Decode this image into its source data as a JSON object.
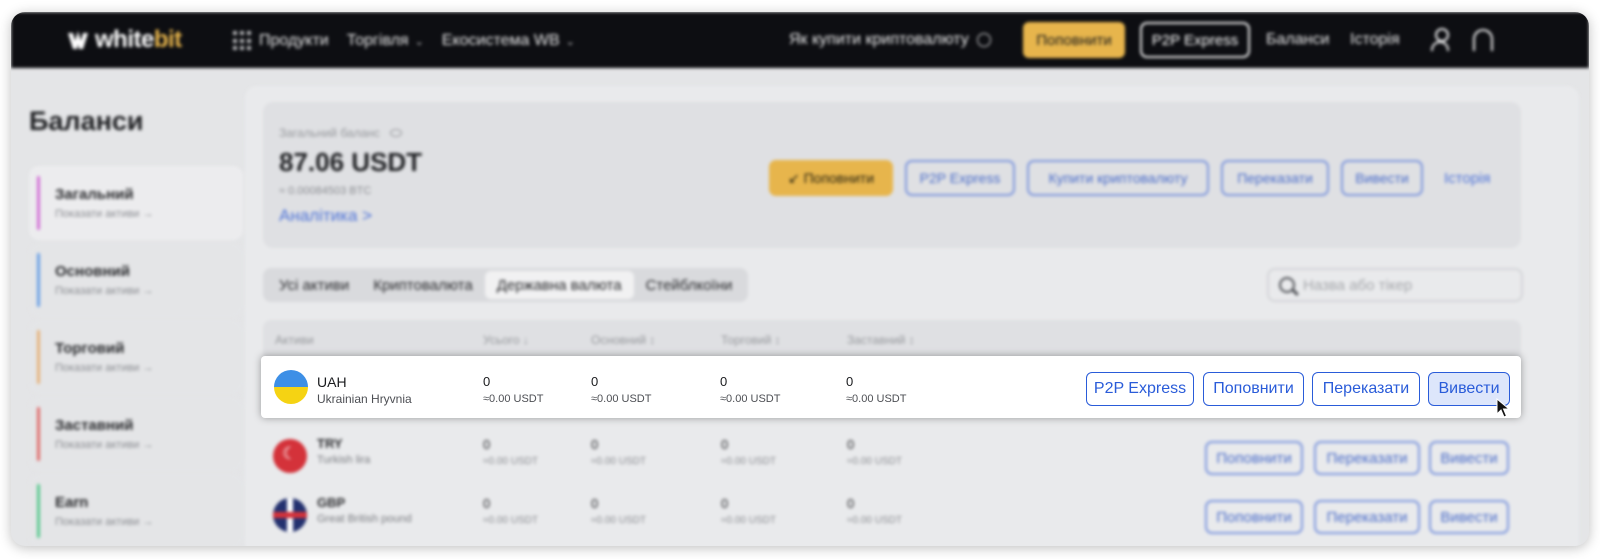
{
  "nav": {
    "logo_left": "white",
    "logo_right": "bit",
    "products": "Продукти",
    "trading": "Торгівля",
    "ecosystem": "Екосистема WB",
    "how_to_buy": "Як купити криптовалюту",
    "deposit": "Поповнити",
    "p2p": "P2P Express",
    "balances": "Баланси",
    "history": "Історія"
  },
  "sidebar": {
    "title": "Баланси",
    "items": [
      {
        "label": "Загальний",
        "sub": "Показати активи →",
        "color": "#d36fd6"
      },
      {
        "label": "Основний",
        "sub": "Показати активи →",
        "color": "#6aa0e6"
      },
      {
        "label": "Торговий",
        "sub": "Показати активи →",
        "color": "#e6b27a"
      },
      {
        "label": "Заставний",
        "sub": "Показати активи →",
        "color": "#e06b6b"
      },
      {
        "label": "Earn",
        "sub": "Показати активи →",
        "color": "#58c98e"
      }
    ]
  },
  "balance": {
    "label": "Загальний баланс",
    "value": "87.06 USDT",
    "btc": "≈ 0.00084503 BTC",
    "analytics": "Аналітика  >",
    "buttons": {
      "deposit": "↙ Поповнити",
      "p2p": "P2P Express",
      "buy_crypto": "Купити криптовалюту",
      "transfer": "Переказати",
      "withdraw": "Вивести",
      "history": "Історія"
    }
  },
  "filters": {
    "tabs": [
      "Усі активи",
      "Криптовалюта",
      "Державна валюта",
      "Стейблкоїни"
    ],
    "active_tab": "Державна валюта",
    "search_placeholder": "Назва або тікер"
  },
  "table": {
    "headers": [
      "Активи",
      "Усього ↓",
      "Основний ↕",
      "Торговий ↕",
      "Заставний ↕"
    ],
    "rows": [
      {
        "code": "UAH",
        "name": "Ukrainian Hryvnia",
        "total": "0",
        "total_usdt": "≈0.00 USDT",
        "main": "0",
        "main_usdt": "≈0.00 USDT",
        "trade": "0",
        "trade_usdt": "≈0.00 USDT",
        "collateral": "0",
        "collateral_usdt": "≈0.00 USDT",
        "actions": [
          "P2P Express",
          "Поповнити",
          "Переказати",
          "Вивести"
        ]
      },
      {
        "code": "TRY",
        "name": "Turkish lira",
        "total": "0",
        "total_usdt": "≈0.00 USDT",
        "main": "0",
        "main_usdt": "≈0.00 USDT",
        "trade": "0",
        "trade_usdt": "≈0.00 USDT",
        "collateral": "0",
        "collateral_usdt": "≈0.00 USDT",
        "actions": [
          "Поповнити",
          "Переказати",
          "Вивести"
        ]
      },
      {
        "code": "GBP",
        "name": "Great British pound",
        "total": "0",
        "total_usdt": "≈0.00 USDT",
        "main": "0",
        "main_usdt": "≈0.00 USDT",
        "trade": "0",
        "trade_usdt": "≈0.00 USDT",
        "collateral": "0",
        "collateral_usdt": "≈0.00 USDT",
        "actions": [
          "Поповнити",
          "Переказати",
          "Вивести"
        ]
      }
    ]
  },
  "colors": {
    "brand_yellow": "#e7b54c",
    "action_blue": "#2a5cd9",
    "nav_bg": "#0d0e12"
  }
}
